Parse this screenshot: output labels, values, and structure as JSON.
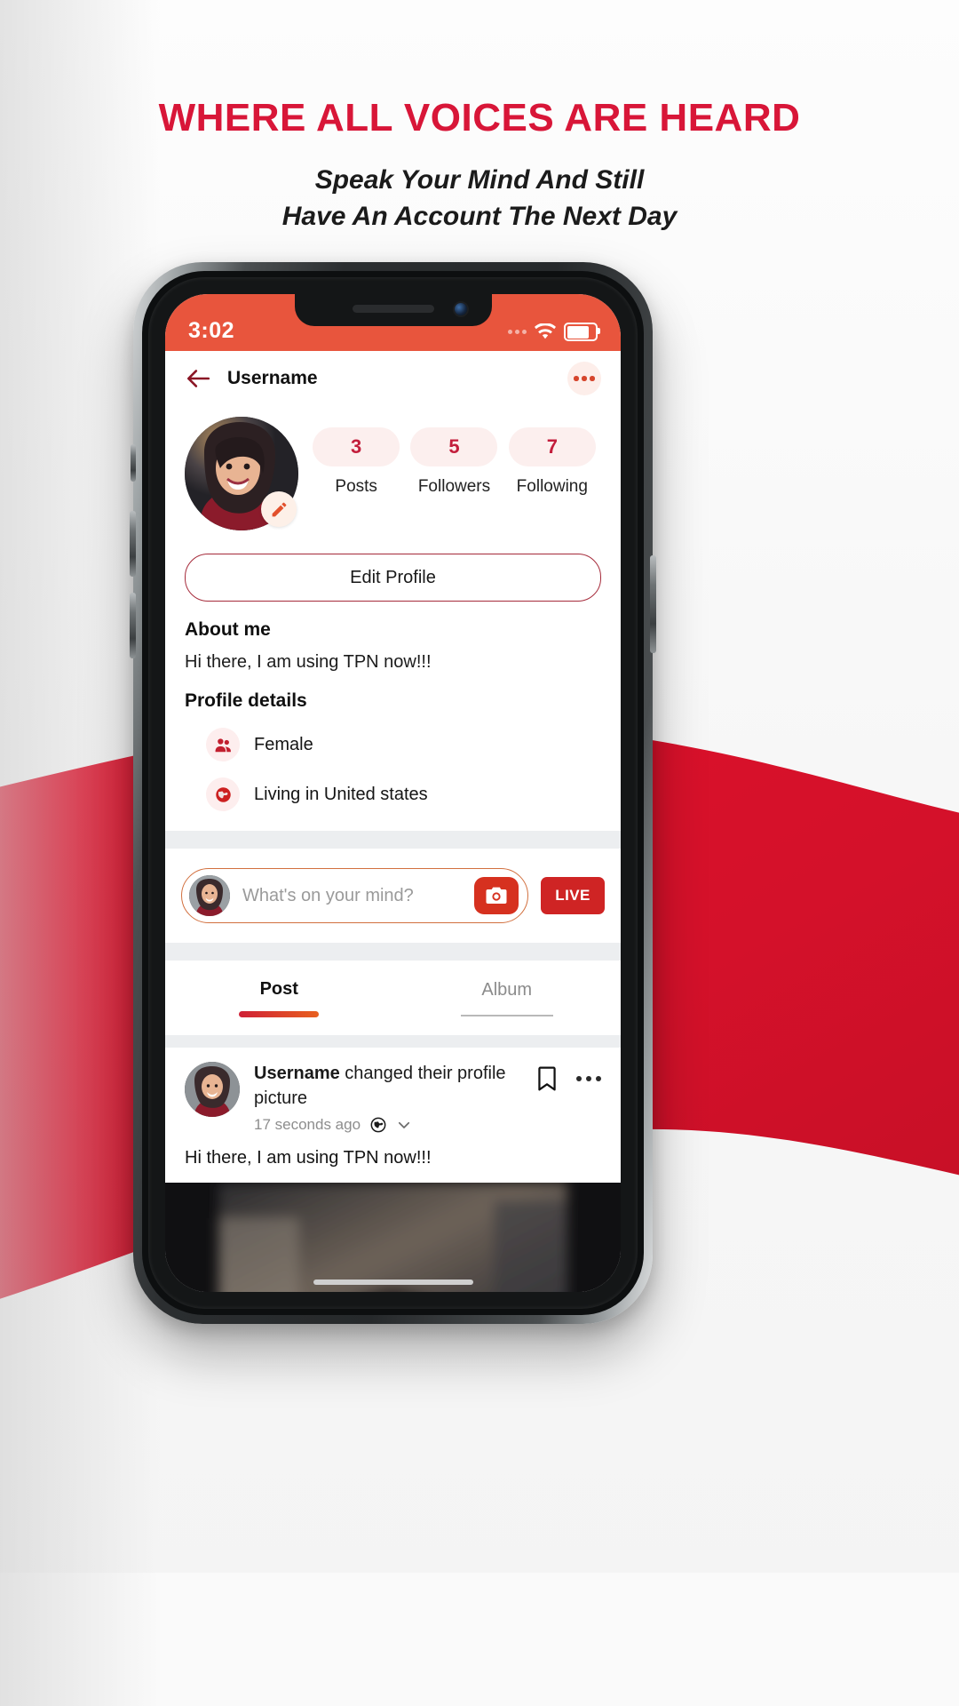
{
  "promo": {
    "headline": "WHERE ALL VOICES ARE HEARD",
    "subline_1": "Speak Your Mind And Still",
    "subline_2": "Have An Account The Next Day",
    "headline_color": "#d81638"
  },
  "status_bar": {
    "time": "3:02",
    "wifi_icon": "wifi-icon",
    "battery_icon": "battery-icon",
    "background_color": "#e8553d"
  },
  "appbar": {
    "back_icon": "back-arrow-icon",
    "title": "Username",
    "more_icon": "more-options-icon"
  },
  "profile": {
    "avatar_alt": "profile-avatar",
    "edit_badge_icon": "pencil-icon",
    "stats": [
      {
        "value": "3",
        "label": "Posts"
      },
      {
        "value": "5",
        "label": "Followers"
      },
      {
        "value": "7",
        "label": "Following"
      }
    ],
    "edit_profile_label": "Edit Profile",
    "about_title": "About me",
    "about_text": "Hi there, I am using TPN now!!!",
    "details_title": "Profile details",
    "details": [
      {
        "icon": "people-icon",
        "label": "Female"
      },
      {
        "icon": "globe-icon",
        "label": "Living in United states"
      }
    ],
    "accent_color": "#c31e3c",
    "pill_background": "#fcefee"
  },
  "composer": {
    "avatar_alt": "composer-avatar",
    "placeholder": "What's on your mind?",
    "camera_icon": "camera-icon",
    "live_label": "LIVE",
    "border_color": "#d2703f"
  },
  "tabs": [
    {
      "label": "Post",
      "active": true
    },
    {
      "label": "Album",
      "active": false
    }
  ],
  "feed": [
    {
      "avatar_alt": "post-author-avatar",
      "author": "Username",
      "action": "changed their profile picture",
      "timestamp": "17 seconds ago",
      "privacy_icon": "globe-icon",
      "privacy_dropdown_icon": "chevron-down-icon",
      "bookmark_icon": "bookmark-icon",
      "more_icon": "more-options-icon",
      "body": "Hi there, I am using TPN now!!!",
      "image_alt": "post-photo"
    }
  ]
}
